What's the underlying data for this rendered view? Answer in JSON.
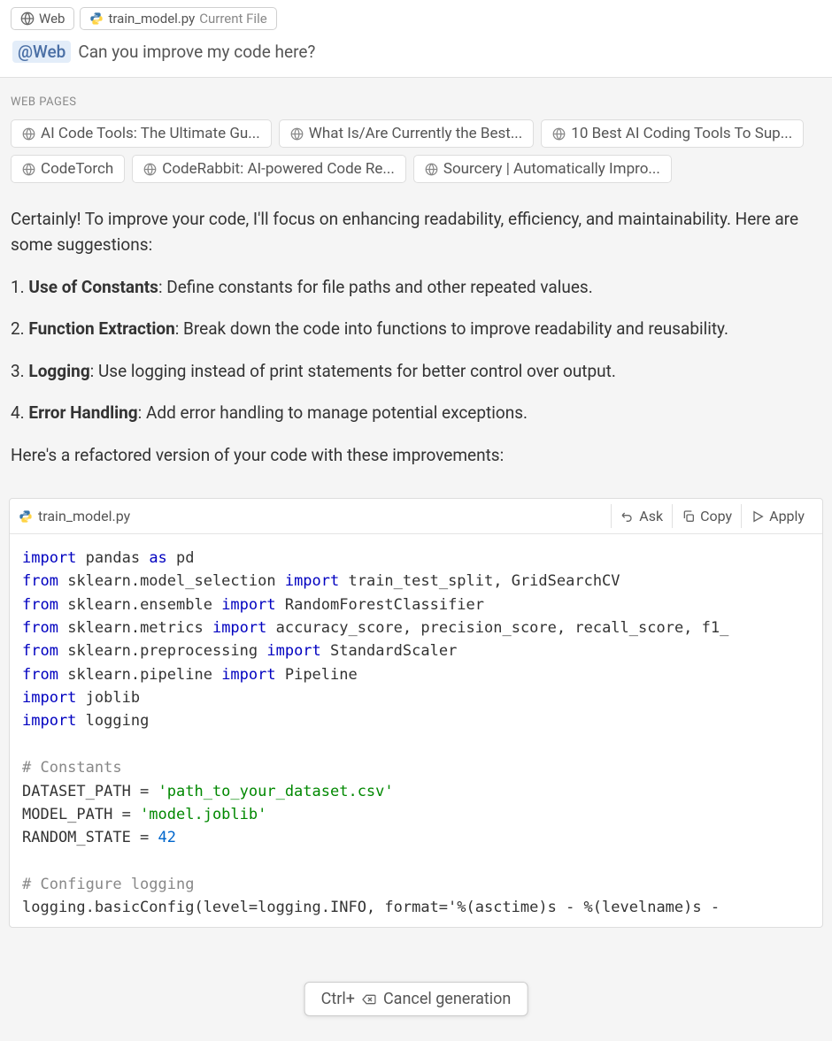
{
  "contextChips": {
    "web": "Web",
    "file": "train_model.py",
    "fileSuffix": "Current File"
  },
  "query": {
    "mention": "@Web",
    "text": "Can you improve my code here?"
  },
  "webPages": {
    "label": "WEB PAGES",
    "items": [
      "AI Code Tools: The Ultimate Gu...",
      "What Is/Are Currently the Best...",
      "10 Best AI Coding Tools To Sup...",
      "CodeTorch",
      "CodeRabbit: AI-powered Code Re...",
      "Sourcery | Automatically Impro..."
    ]
  },
  "response": {
    "intro": "Certainly! To improve your code, I'll focus on enhancing readability, efficiency, and maintainability. Here are some suggestions:",
    "points": [
      {
        "num": "1.",
        "title": "Use of Constants",
        "desc": ": Define constants for file paths and other repeated values."
      },
      {
        "num": "2.",
        "title": "Function Extraction",
        "desc": ": Break down the code into functions to improve readability and reusability."
      },
      {
        "num": "3.",
        "title": "Logging",
        "desc": ": Use logging instead of print statements for better control over output."
      },
      {
        "num": "4.",
        "title": "Error Handling",
        "desc": ": Add error handling to manage potential exceptions."
      }
    ],
    "outro": "Here's a refactored version of your code with these improvements:"
  },
  "codeBlock": {
    "filename": "train_model.py",
    "actions": {
      "ask": "Ask",
      "copy": "Copy",
      "apply": "Apply"
    },
    "lines": {
      "l1a": "import",
      "l1b": " pandas ",
      "l1c": "as",
      "l1d": " pd",
      "l2a": "from",
      "l2b": " sklearn.model_selection ",
      "l2c": "import",
      "l2d": " train_test_split, GridSearchCV",
      "l3a": "from",
      "l3b": " sklearn.ensemble ",
      "l3c": "import",
      "l3d": " RandomForestClassifier",
      "l4a": "from",
      "l4b": " sklearn.metrics ",
      "l4c": "import",
      "l4d": " accuracy_score, precision_score, recall_score, f1_",
      "l5a": "from",
      "l5b": " sklearn.preprocessing ",
      "l5c": "import",
      "l5d": " StandardScaler",
      "l6a": "from",
      "l6b": " sklearn.pipeline ",
      "l6c": "import",
      "l6d": " Pipeline",
      "l7a": "import",
      "l7b": " joblib",
      "l8a": "import",
      "l8b": " logging",
      "c1": "# Constants",
      "d1a": "DATASET_PATH = ",
      "d1b": "'path_to_your_dataset.csv'",
      "d2a": "MODEL_PATH = ",
      "d2b": "'model.joblib'",
      "d3a": "RANDOM_STATE = ",
      "d3b": "42",
      "c2": "# Configure logging",
      "last": "logging.basicConfig(level=logging.INFO, format='%(asctime)s - %(levelname)s -"
    }
  },
  "cancel": {
    "shortcut": "Ctrl+",
    "label": "Cancel generation"
  }
}
